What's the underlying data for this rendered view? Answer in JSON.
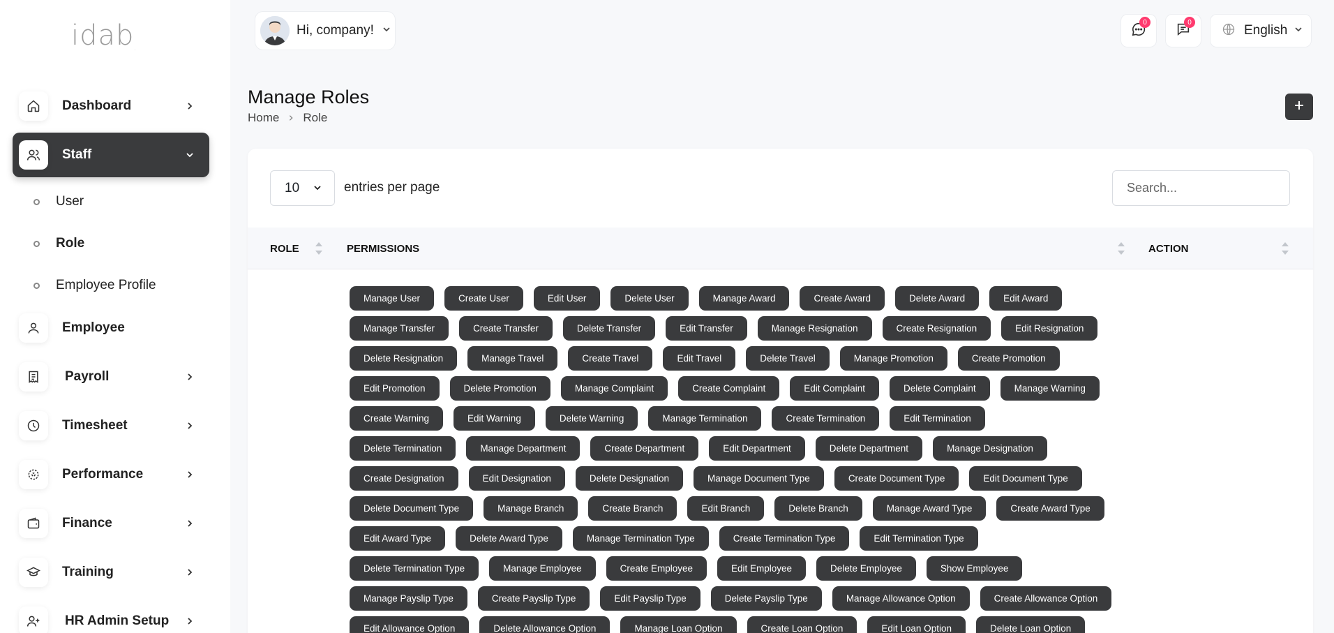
{
  "brand": {
    "logo_text": "idab",
    "logo_tm": "."
  },
  "sidebar": {
    "items": [
      {
        "label": "Dashboard"
      },
      {
        "label": "Staff"
      },
      {
        "label": "Employee"
      },
      {
        "label": "Payroll"
      },
      {
        "label": "Timesheet"
      },
      {
        "label": "Performance"
      },
      {
        "label": "Finance"
      },
      {
        "label": "Training"
      },
      {
        "label": "HR Admin Setup"
      }
    ],
    "staff_sub": [
      {
        "label": "User"
      },
      {
        "label": "Role"
      },
      {
        "label": "Employee Profile"
      }
    ]
  },
  "header": {
    "greeting": "Hi, company!",
    "messages_count": "0",
    "notifications_count": "0",
    "language": "English"
  },
  "page": {
    "title": "Manage Roles",
    "breadcrumb": {
      "home": "Home",
      "current": "Role"
    },
    "add_label": "+"
  },
  "table": {
    "per_page_value": "10",
    "per_page_label": "entries per page",
    "search_placeholder": "Search...",
    "columns": {
      "role": "ROLE",
      "permissions": "PERMISSIONS",
      "action": "ACTION"
    },
    "permission_rows": [
      [
        "Manage User",
        "Create User",
        "Edit User",
        "Delete User",
        "Manage Award",
        "Create Award",
        "Delete Award",
        "Edit Award"
      ],
      [
        "Manage Transfer",
        "Create Transfer",
        "Delete Transfer",
        "Edit Transfer",
        "Manage Resignation",
        "Create Resignation",
        "Edit Resignation"
      ],
      [
        "Delete Resignation",
        "Manage Travel",
        "Create Travel",
        "Edit Travel",
        "Delete Travel",
        "Manage Promotion",
        "Create Promotion"
      ],
      [
        "Edit Promotion",
        "Delete Promotion",
        "Manage Complaint",
        "Create Complaint",
        "Edit Complaint",
        "Delete Complaint",
        "Manage Warning"
      ],
      [
        "Create Warning",
        "Edit Warning",
        "Delete Warning",
        "Manage Termination",
        "Create Termination",
        "Edit Termination"
      ],
      [
        "Delete Termination",
        "Manage Department",
        "Create Department",
        "Edit Department",
        "Delete Department",
        "Manage Designation"
      ],
      [
        "Create Designation",
        "Edit Designation",
        "Delete Designation",
        "Manage Document Type",
        "Create Document Type",
        "Edit Document Type"
      ],
      [
        "Delete Document Type",
        "Manage Branch",
        "Create Branch",
        "Edit Branch",
        "Delete Branch",
        "Manage Award Type",
        "Create Award Type"
      ],
      [
        "Edit Award Type",
        "Delete Award Type",
        "Manage Termination Type",
        "Create Termination Type",
        "Edit Termination Type"
      ],
      [
        "Delete Termination Type",
        "Manage Employee",
        "Create Employee",
        "Edit Employee",
        "Delete Employee",
        "Show Employee"
      ],
      [
        "Manage Payslip Type",
        "Create Payslip Type",
        "Edit Payslip Type",
        "Delete Payslip Type",
        "Manage Allowance Option",
        "Create Allowance Option"
      ],
      [
        "Edit Allowance Option",
        "Delete Allowance Option",
        "Manage Loan Option",
        "Create Loan Option",
        "Edit Loan Option",
        "Delete Loan Option"
      ]
    ]
  }
}
